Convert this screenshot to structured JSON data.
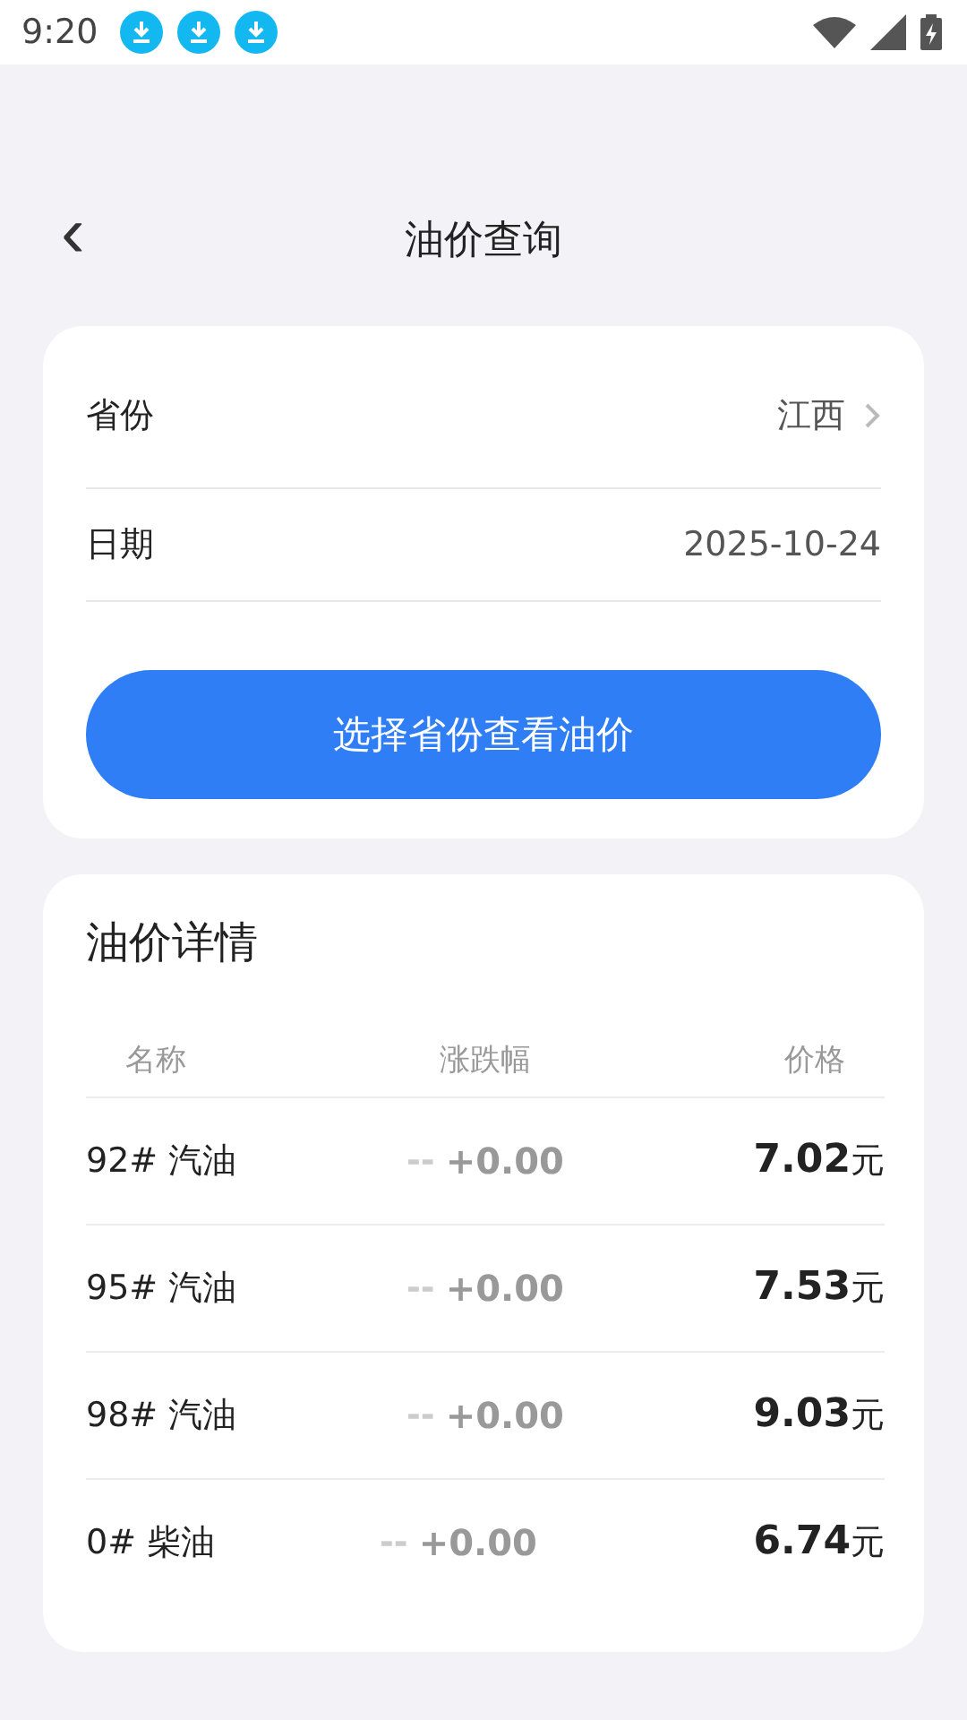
{
  "status_bar": {
    "time": "9:20",
    "notifications": [
      {
        "kind": "download"
      },
      {
        "kind": "download"
      },
      {
        "kind": "download"
      }
    ]
  },
  "header": {
    "back": "‹",
    "title": "油价查询"
  },
  "query": {
    "fields": [
      {
        "label": "省份",
        "value": "江西",
        "kind": "picker"
      },
      {
        "label": "日期",
        "value": "2025-10-24",
        "kind": "text"
      }
    ],
    "button": "选择省份查看油价"
  },
  "details": {
    "title": "油价详情",
    "columns": [
      "名称",
      "涨跌幅",
      "价格"
    ],
    "rows": [
      {
        "name": "92# 汽油",
        "trend": "--",
        "change": "+0.00",
        "price": "**7.02**元"
      },
      {
        "name": "95# 汽油",
        "trend": "--",
        "change": "+0.00",
        "price": "**7.53**元"
      },
      {
        "name": "98# 汽油",
        "trend": "--",
        "change": "+0.00",
        "price": "**9.03**元"
      },
      {
        "name": "0# 柴油",
        "trend": "--",
        "change": "+0.00",
        "price": "**6.74**元"
      }
    ]
  }
}
